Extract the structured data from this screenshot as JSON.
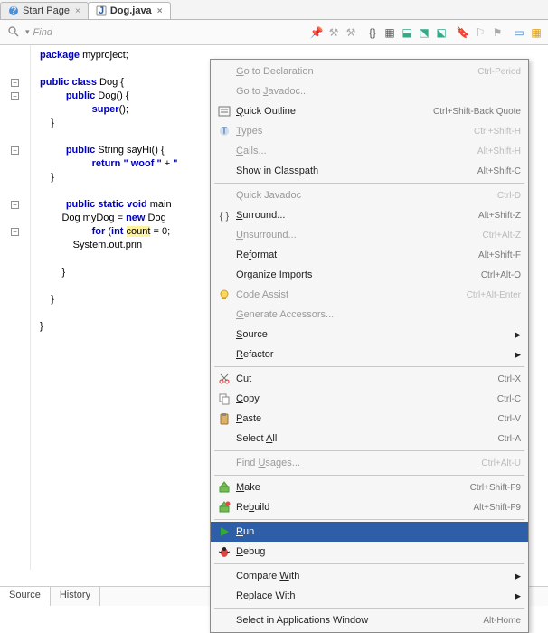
{
  "tabs": [
    {
      "label": "Start Page",
      "active": false
    },
    {
      "label": "Dog.java",
      "active": true
    }
  ],
  "find": {
    "placeholder": "Find"
  },
  "code": {
    "l1a": "package",
    "l1b": " myproject;",
    "l3a": "public",
    "l3b": " ",
    "l3c": "class",
    "l3d": " Dog {",
    "l4a": "public",
    "l4b": " Dog() {",
    "l5a": "super",
    "l5b": "();",
    "l6": "    }",
    "l8a": "public",
    "l8b": " String sayHi() {",
    "l9a": "return",
    "l9b": " ",
    "l9c": "\" woof \"",
    "l9d": " + ",
    "l9e": "\"",
    "l10": "    }",
    "l12a": "public",
    "l12b": " ",
    "l12c": "static",
    "l12d": " ",
    "l12e": "void",
    "l12f": " main",
    "l13": "        Dog myDog = ",
    "l13a": "new",
    "l13b": " Dog",
    "l14a": "for",
    "l14b": " (",
    "l14c": "int",
    "l14d": " ",
    "l14e": "count",
    "l14f": " = 0;",
    "l15": "            System.out.prin",
    "l17": "        }",
    "l19": "    }",
    "l21": "}"
  },
  "bottomTabs": [
    {
      "label": "Source"
    },
    {
      "label": "History"
    }
  ],
  "menu": [
    {
      "t": "i",
      "label": "Go to Declaration",
      "sc": "Ctrl-Period",
      "dis": true,
      "u": 0
    },
    {
      "t": "i",
      "label": "Go to Javadoc...",
      "dis": true,
      "u": 6
    },
    {
      "t": "i",
      "label": "Quick Outline",
      "sc": "Ctrl+Shift-Back Quote",
      "icon": "outline",
      "u": 0
    },
    {
      "t": "i",
      "label": "Types",
      "sc": "Ctrl+Shift-H",
      "dis": true,
      "icon": "types",
      "u": 0
    },
    {
      "t": "i",
      "label": "Calls...",
      "sc": "Alt+Shift-H",
      "dis": true,
      "u": 0
    },
    {
      "t": "i",
      "label": "Show in Classpath",
      "sc": "Alt+Shift-C",
      "u": 13
    },
    {
      "t": "s"
    },
    {
      "t": "i",
      "label": "Quick Javadoc",
      "sc": "Ctrl-D",
      "dis": true
    },
    {
      "t": "i",
      "label": "Surround...",
      "sc": "Alt+Shift-Z",
      "icon": "surround",
      "u": 0
    },
    {
      "t": "i",
      "label": "Unsurround...",
      "sc": "Ctrl+Alt-Z",
      "dis": true,
      "u": 0
    },
    {
      "t": "i",
      "label": "Reformat",
      "sc": "Alt+Shift-F",
      "u": 2
    },
    {
      "t": "i",
      "label": "Organize Imports",
      "sc": "Ctrl+Alt-O",
      "u": 0
    },
    {
      "t": "i",
      "label": "Code Assist",
      "sc": "Ctrl+Alt-Enter",
      "dis": true,
      "icon": "bulb"
    },
    {
      "t": "i",
      "label": "Generate Accessors...",
      "dis": true,
      "u": 0
    },
    {
      "t": "i",
      "label": "Source",
      "sub": true,
      "u": 0
    },
    {
      "t": "i",
      "label": "Refactor",
      "sub": true,
      "u": 0
    },
    {
      "t": "s"
    },
    {
      "t": "i",
      "label": "Cut",
      "sc": "Ctrl-X",
      "icon": "cut",
      "u": 2
    },
    {
      "t": "i",
      "label": "Copy",
      "sc": "Ctrl-C",
      "icon": "copy",
      "u": 0
    },
    {
      "t": "i",
      "label": "Paste",
      "sc": "Ctrl-V",
      "icon": "paste",
      "u": 0
    },
    {
      "t": "i",
      "label": "Select All",
      "sc": "Ctrl-A",
      "u": 7
    },
    {
      "t": "s"
    },
    {
      "t": "i",
      "label": "Find Usages...",
      "sc": "Ctrl+Alt-U",
      "dis": true,
      "u": 5
    },
    {
      "t": "s"
    },
    {
      "t": "i",
      "label": "Make",
      "sc": "Ctrl+Shift-F9",
      "icon": "make",
      "u": 0
    },
    {
      "t": "i",
      "label": "Rebuild",
      "sc": "Alt+Shift-F9",
      "icon": "rebuild",
      "u": 2
    },
    {
      "t": "s"
    },
    {
      "t": "i",
      "label": "Run",
      "icon": "run",
      "sel": true,
      "u": 0
    },
    {
      "t": "i",
      "label": "Debug",
      "icon": "debug",
      "u": 0
    },
    {
      "t": "s"
    },
    {
      "t": "i",
      "label": "Compare With",
      "sub": true,
      "u": 8
    },
    {
      "t": "i",
      "label": "Replace With",
      "sub": true,
      "u": 8
    },
    {
      "t": "s"
    },
    {
      "t": "i",
      "label": "Select in Applications Window",
      "sc": "Alt-Home"
    }
  ]
}
